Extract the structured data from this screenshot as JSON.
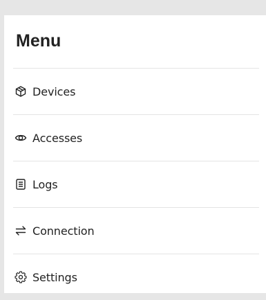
{
  "menu": {
    "title": "Menu",
    "items": [
      {
        "label": "Devices",
        "icon": "box-icon"
      },
      {
        "label": "Accesses",
        "icon": "eye-icon"
      },
      {
        "label": "Logs",
        "icon": "document-list-icon"
      },
      {
        "label": "Connection",
        "icon": "arrows-swap-icon"
      },
      {
        "label": "Settings",
        "icon": "gear-icon"
      }
    ]
  }
}
